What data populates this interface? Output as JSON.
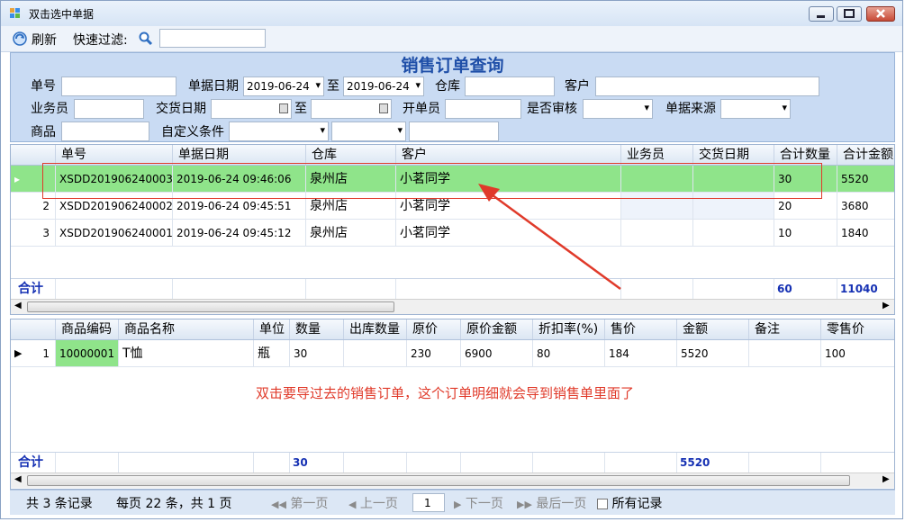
{
  "window": {
    "title": "双击选中单据"
  },
  "toolbar": {
    "refresh_label": "刷新",
    "quick_filter_label": "快速过滤:",
    "quick_filter_value": ""
  },
  "form": {
    "title": "销售订单查询",
    "order_no_label": "单号",
    "order_no_value": "",
    "doc_date_label": "单据日期",
    "doc_date_from": "2019-06-24",
    "to_label": "至",
    "doc_date_to": "2019-06-24",
    "warehouse_label": "仓库",
    "warehouse_value": "",
    "customer_label": "客户",
    "customer_value": "",
    "salesman_label": "业务员",
    "salesman_value": "",
    "delivery_date_label": "交货日期",
    "delivery_to_label": "至",
    "creator_label": "开单员",
    "creator_value": "",
    "audited_label": "是否审核",
    "audited_value": "",
    "source_label": "单据来源",
    "source_value": "",
    "product_label": "商品",
    "product_value": "",
    "custom_condition_label": "自定义条件"
  },
  "orders": {
    "columns": [
      "单号",
      "单据日期",
      "仓库",
      "客户",
      "业务员",
      "交货日期",
      "合计数量",
      "合计金额"
    ],
    "rows": [
      {
        "num": "1",
        "order_no": "XSDD201906240003",
        "date": "2019-06-24 09:46:06",
        "warehouse": "泉州店",
        "customer": "小茗同学",
        "salesman": "",
        "delivery": "",
        "qty": "30",
        "amount": "5520"
      },
      {
        "num": "2",
        "order_no": "XSDD201906240002",
        "date": "2019-06-24 09:45:51",
        "warehouse": "泉州店",
        "customer": "小茗同学",
        "salesman": "",
        "delivery": "",
        "qty": "20",
        "amount": "3680"
      },
      {
        "num": "3",
        "order_no": "XSDD201906240001",
        "date": "2019-06-24 09:45:12",
        "warehouse": "泉州店",
        "customer": "小茗同学",
        "salesman": "",
        "delivery": "",
        "qty": "10",
        "amount": "1840"
      }
    ],
    "total_label": "合计",
    "total_qty": "60",
    "total_amount": "11040"
  },
  "details": {
    "columns": [
      "商品编码",
      "商品名称",
      "单位",
      "数量",
      "出库数量",
      "原价",
      "原价金额",
      "折扣率(%)",
      "售价",
      "金额",
      "备注",
      "零售价"
    ],
    "rows": [
      {
        "num": "1",
        "code": "10000001",
        "name": "T恤",
        "unit": "瓶",
        "qty": "30",
        "out_qty": "",
        "price": "230",
        "price_amount": "6900",
        "discount": "80",
        "sale_price": "184",
        "amount": "5520",
        "remark": "",
        "retail": "100"
      }
    ],
    "total_label": "合计",
    "total_qty": "30",
    "total_amount": "5520"
  },
  "annotation": {
    "text": "双击要导过去的销售订单，这个订单明细就会导到销售单里面了",
    "color": "#e03a2a"
  },
  "statusbar": {
    "records": "共 3 条记录",
    "per_page": "每页 22 条，共 1 页",
    "first": "第一页",
    "prev": "上一页",
    "page": "1",
    "next": "下一页",
    "last": "最后一页",
    "all_records": "所有记录"
  },
  "colors": {
    "selected_row": "#8fe48a",
    "code_cell": "#8fe48a",
    "title_blue": "#1f4fa8",
    "total_blue": "#1530b3"
  }
}
